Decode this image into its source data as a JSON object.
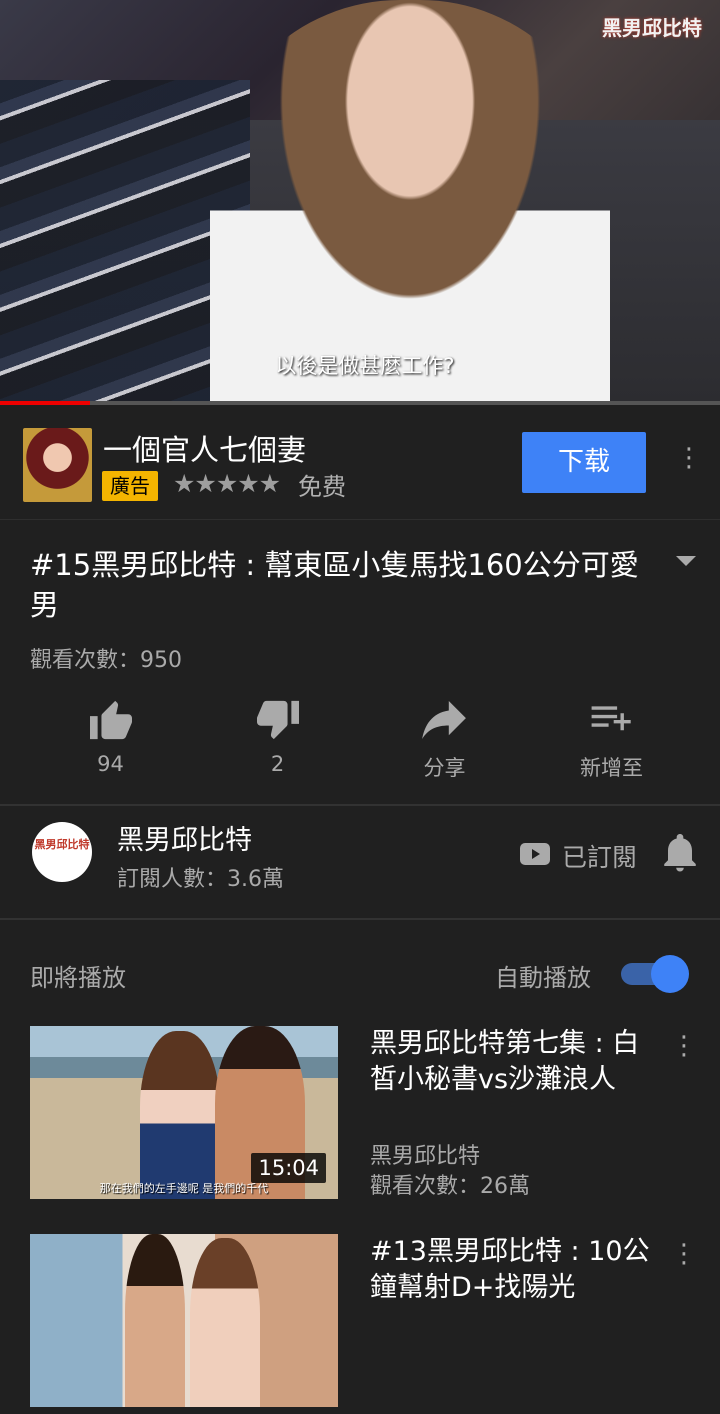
{
  "player": {
    "subtitle": "以後是做甚麼工作?",
    "watermark": "黑男邱比特",
    "progress": 0.125
  },
  "ad": {
    "title": "一個官人七個妻",
    "badge": "廣告",
    "stars": "★★★★★",
    "price": "免费",
    "button": "下载"
  },
  "video": {
    "title": "#15黑男邱比特 : 幫東區小隻馬找160公分可愛男",
    "views": "觀看次數：950"
  },
  "actions": {
    "like_count": "94",
    "dislike_count": "2",
    "share_label": "分享",
    "add_label": "新增至"
  },
  "channel": {
    "name": "黑男邱比特",
    "avatar_text": "黑男邱比特",
    "subscribers": "訂閱人數：3.6萬",
    "subscribe_label": "已訂閱"
  },
  "upnext": {
    "label": "即將播放",
    "autoplay_label": "自動播放",
    "autoplay_on": true
  },
  "videos": [
    {
      "title": "黑男邱比特第七集 : 白皙小秘書vs沙灘浪人",
      "channel": "黑男邱比特",
      "views": "觀看次數：26萬",
      "duration": "15:04",
      "thumb_caption": "那在我們的左手邊呢 是我們的千代"
    },
    {
      "title": "#13黑男邱比特 : 10公鐘幫射D+找陽光",
      "channel": "",
      "views": "",
      "duration": ""
    }
  ],
  "colors": {
    "background": "#202020",
    "accent_blue": "#3e82f7",
    "progress_red": "#ee0000",
    "ad_badge": "#f4b400"
  }
}
